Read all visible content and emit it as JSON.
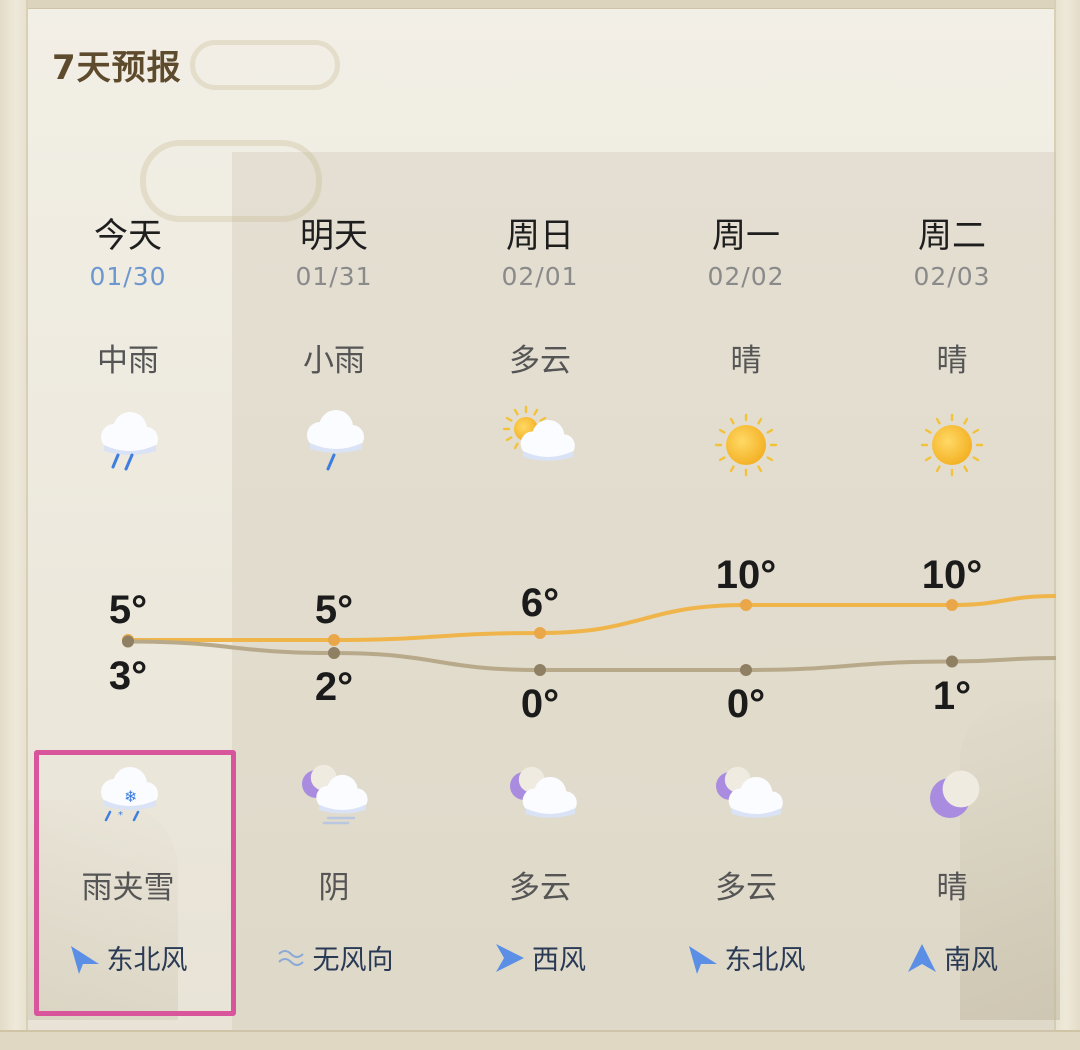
{
  "header": {
    "title": "7天预报"
  },
  "days": [
    {
      "name": "今天",
      "date": "01/30",
      "day_condition": "中雨",
      "day_icon": "moderate-rain-icon",
      "high": "5°",
      "low": "3°",
      "night_icon": "sleet-icon",
      "night_condition": "雨夹雪",
      "wind": "东北风",
      "wind_icon": "wind-arrow-northeast-icon",
      "is_today": true
    },
    {
      "name": "明天",
      "date": "01/31",
      "day_condition": "小雨",
      "day_icon": "light-rain-icon",
      "high": "5°",
      "low": "2°",
      "night_icon": "overcast-night-icon",
      "night_condition": "阴",
      "wind": "无风向",
      "wind_icon": "no-wind-direction-icon"
    },
    {
      "name": "周日",
      "date": "02/01",
      "day_condition": "多云",
      "day_icon": "partly-cloudy-day-icon",
      "high": "6°",
      "low": "0°",
      "night_icon": "partly-cloudy-night-icon",
      "night_condition": "多云",
      "wind": "西风",
      "wind_icon": "wind-arrow-west-icon"
    },
    {
      "name": "周一",
      "date": "02/02",
      "day_condition": "晴",
      "day_icon": "sunny-icon",
      "high": "10°",
      "low": "0°",
      "night_icon": "partly-cloudy-night-icon",
      "night_condition": "多云",
      "wind": "东北风",
      "wind_icon": "wind-arrow-northeast-icon"
    },
    {
      "name": "周二",
      "date": "02/03",
      "day_condition": "晴",
      "day_icon": "sunny-icon",
      "high": "10°",
      "low": "1°",
      "night_icon": "clear-night-moon-icon",
      "night_condition": "晴",
      "wind": "南风",
      "wind_icon": "wind-arrow-south-icon"
    }
  ],
  "chart_data": {
    "type": "line",
    "categories": [
      "01/30",
      "01/31",
      "02/01",
      "02/02",
      "02/03"
    ],
    "series": [
      {
        "values": [
          5,
          5,
          6,
          10,
          10
        ],
        "color": "#f0b54a"
      },
      {
        "values": [
          3,
          2,
          0,
          0,
          1
        ],
        "color": "#b8a98a"
      }
    ]
  },
  "colors": {
    "accent_today": "#6d97cf",
    "highlight": "#d8549b",
    "wind_arrow": "#5b8fe6"
  }
}
